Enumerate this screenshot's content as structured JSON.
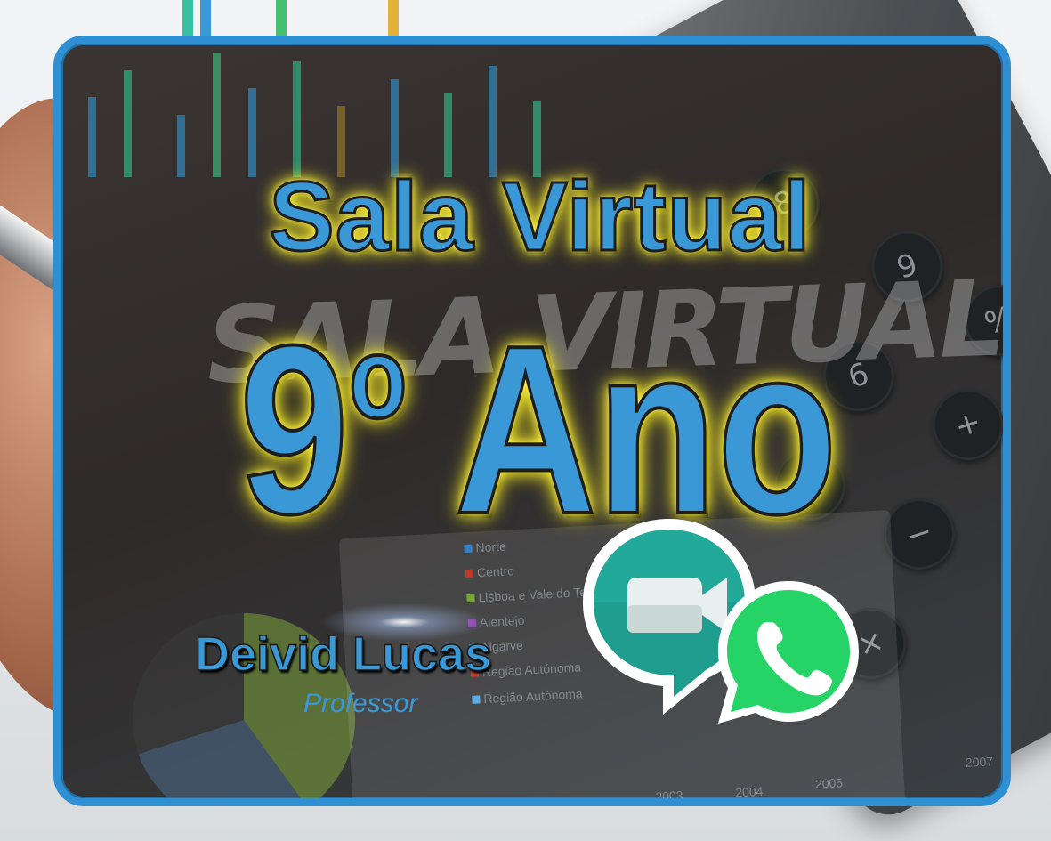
{
  "title": {
    "line1": "Sala Virtual",
    "grade_number": "9",
    "grade_ordinal": "o",
    "grade_word": "Ano",
    "background_brush_text": "SALA VIRTUAL"
  },
  "teacher": {
    "name": "Deivid Lucas",
    "role": "Professor"
  },
  "background_chart_legend": [
    "Norte",
    "Centro",
    "Lisboa e Vale do Tejo",
    "Alentejo",
    "Algarve",
    "Região Autónoma",
    "Região Autónoma"
  ],
  "background_chart_years": [
    "2003",
    "2004",
    "2005",
    "2007"
  ],
  "background_calculator_keys": [
    "8",
    "9",
    "6",
    "3",
    "+",
    "−",
    "×",
    "%"
  ],
  "icons": {
    "meet": "google-meet-icon",
    "whatsapp": "whatsapp-icon"
  },
  "colors": {
    "frame_border": "#2f8fd3",
    "title_fill": "#3b98d6",
    "title_glow": "#fff34a",
    "whatsapp_green": "#25d366",
    "meet_teal": "#1f9e8f"
  }
}
